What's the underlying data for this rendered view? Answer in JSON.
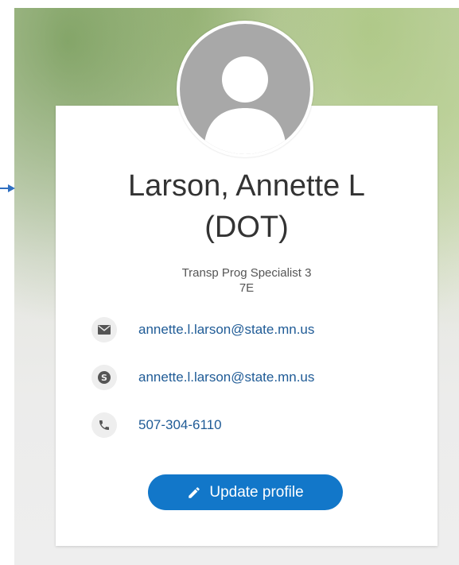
{
  "profile": {
    "name_line1": "Larson, Annette L",
    "name_line2": "(DOT)",
    "title": "Transp Prog Specialist 3",
    "location": "7E"
  },
  "contacts": [
    {
      "icon": "mail-icon",
      "value": "annette.l.larson@state.mn.us"
    },
    {
      "icon": "skype-icon",
      "value": "annette.l.larson@state.mn.us"
    },
    {
      "icon": "phone-icon",
      "value": "507-304-6110"
    }
  ],
  "actions": {
    "update_profile_label": "Update profile",
    "update_profile_icon": "pencil-icon"
  },
  "colors": {
    "accent": "#1277c9",
    "link": "#1f5b96",
    "avatar": "#a8a8a8",
    "icon_bg": "#eeeeee",
    "icon_fg": "#555555",
    "arrow": "#2f6fc1"
  }
}
